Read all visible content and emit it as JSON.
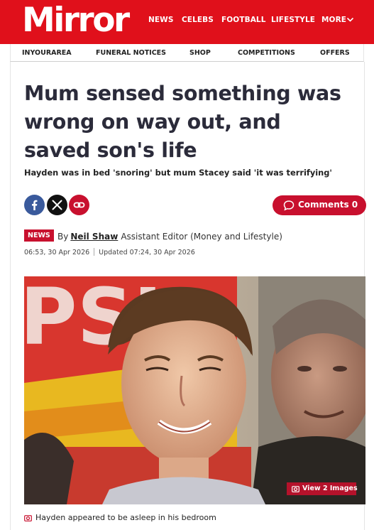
{
  "header": {
    "logo": "Mirror",
    "nav": [
      "NEWS",
      "CELEBS",
      "FOOTBALL",
      "LIFESTYLE",
      "MORE"
    ],
    "brand_color": "#e0101b"
  },
  "subnav": [
    "INYOURAREA",
    "FUNERAL NOTICES",
    "SHOP",
    "COMPETITIONS",
    "OFFERS"
  ],
  "article": {
    "headline": "Mum sensed something was wrong on way out, and saved son's life",
    "standfirst": "Hayden was in bed 'snoring' but mum Stacey said 'it was terrifying'",
    "share_icons": [
      "facebook-icon",
      "x-icon",
      "link-icon"
    ],
    "comments_label": "Comments 0",
    "category_badge": "NEWS",
    "byline_prefix": "By",
    "author": "Neil Shaw",
    "author_role": "Assistant Editor (Money and Lifestyle)",
    "published": "06:53, 30 Apr 2026",
    "updated": "Updated 07:24, 30 Apr 2026",
    "accent_color": "#c8102e"
  },
  "image": {
    "view_label": "View 2 Images",
    "caption": "Hayden appeared to be asleep in his bedroom"
  }
}
